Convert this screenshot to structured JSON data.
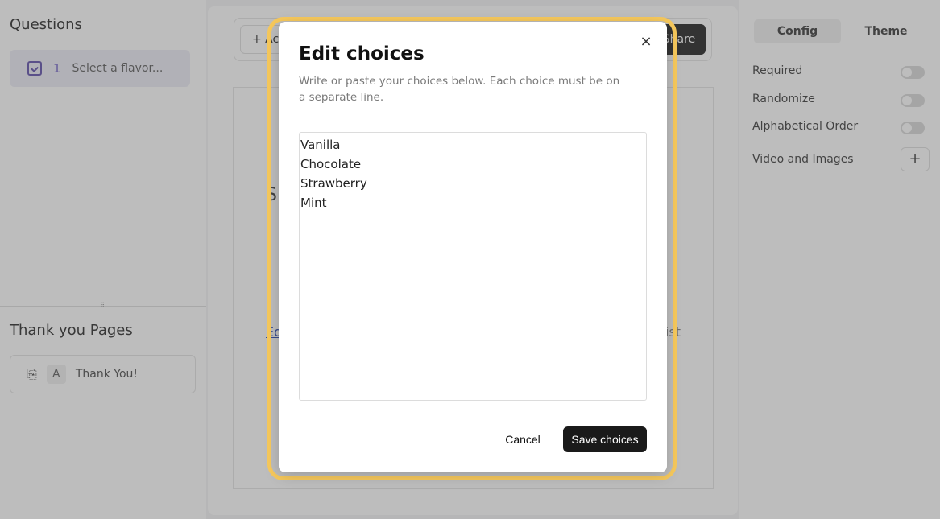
{
  "left_panel": {
    "title": "Questions",
    "questions": [
      {
        "number": "1",
        "label": "Select a flavor..."
      }
    ],
    "thank_you_title": "Thank you Pages",
    "thank_you_pages": [
      {
        "letter": "A",
        "label": "Thank You!"
      }
    ]
  },
  "toolbar": {
    "add_label": "+ Ac",
    "share_label": "Share"
  },
  "canvas": {
    "partial_title": "S",
    "partial_link": "Ed",
    "partial_text": "ist"
  },
  "right_panel": {
    "tabs": [
      "Config",
      "Theme"
    ],
    "settings": {
      "required": "Required",
      "randomize": "Randomize",
      "alphabetical": "Alphabetical Order",
      "media": "Video and Images"
    }
  },
  "modal": {
    "title": "Edit choices",
    "description": "Write or paste your choices below. Each choice must be on a separate line.",
    "choices_text": "Vanilla\nChocolate\nStrawberry\nMint",
    "cancel_label": "Cancel",
    "save_label": "Save choices",
    "close_symbol": "×"
  },
  "colors": {
    "highlight": "#f7c95c",
    "primary_button": "#1a1a1a",
    "accent": "#6b5bc5"
  }
}
